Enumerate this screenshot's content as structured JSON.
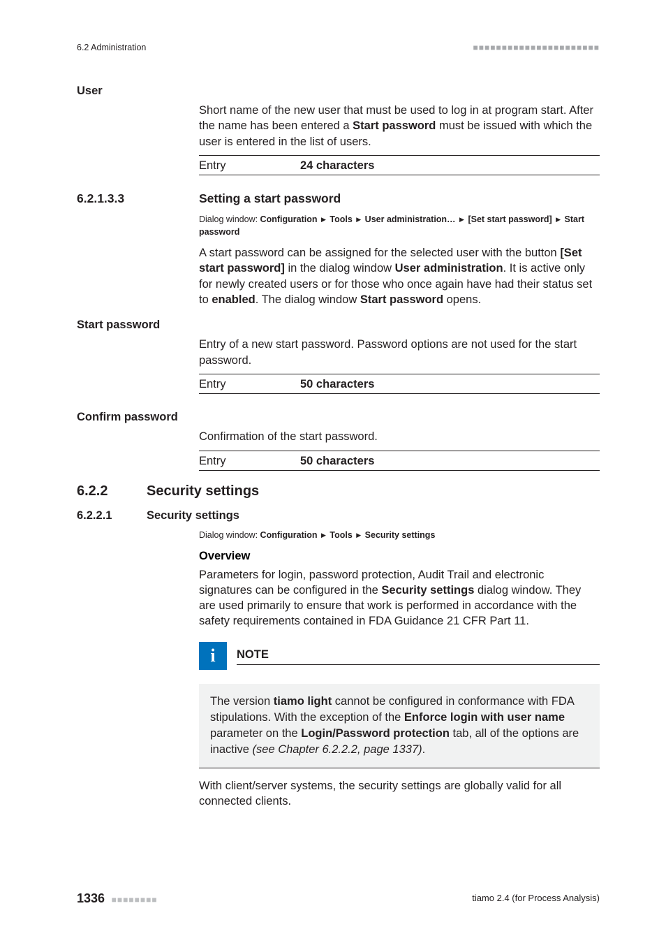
{
  "running_head": {
    "left": "6.2 Administration",
    "dots": "■■■■■■■■■■■■■■■■■■■■■■"
  },
  "user": {
    "label": "User",
    "para": "Short name of the new user that must be used to log in at program start. After the name has been entered a ",
    "bold_in_para": "Start password",
    "para_tail": " must be issued with which the user is entered in the list of users.",
    "entry_label": "Entry",
    "entry_value": "24 characters"
  },
  "sec_61_3_3": {
    "num": "6.2.1.3.3",
    "title": "Setting a start password",
    "dialog_prefix": "Dialog window: ",
    "dialog": [
      "Configuration",
      "Tools",
      "User administration…",
      "[Set start password]",
      "Start password"
    ],
    "para_parts": [
      "A start password can be assigned for the selected user with the button ",
      "[Set start password]",
      " in the dialog window ",
      "User administration",
      ". It is active only for newly created users or for those who once again have had their status set to ",
      "enabled",
      ". The dialog window ",
      "Start password",
      " opens."
    ]
  },
  "start_password": {
    "label": "Start password",
    "para": "Entry of a new start password. Password options are not used for the start password.",
    "entry_label": "Entry",
    "entry_value": "50 characters"
  },
  "confirm_password": {
    "label": "Confirm password",
    "para": "Confirmation of the start password.",
    "entry_label": "Entry",
    "entry_value": "50 characters"
  },
  "sec_622": {
    "num": "6.2.2",
    "title": "Security settings"
  },
  "sec_6221": {
    "num": "6.2.2.1",
    "title": "Security settings",
    "dialog_prefix": "Dialog window: ",
    "dialog": [
      "Configuration",
      "Tools",
      "Security settings"
    ],
    "overview_label": "Overview",
    "overview_parts": [
      "Parameters for login, password protection, Audit Trail and electronic signatures can be configured in the ",
      "Security settings",
      " dialog window. They are used primarily to ensure that work is performed in accordance with the safety requirements contained in FDA Guidance 21 CFR Part 11."
    ]
  },
  "note": {
    "title": "NOTE",
    "body_parts": [
      "The version ",
      "tiamo light",
      " cannot be configured in conformance with FDA stipulations. With the exception of the ",
      "Enforce login with user name",
      " parameter on the ",
      "Login/Password protection",
      " tab, all of the options are inactive ",
      "(see Chapter 6.2.2.2, page 1337)",
      "."
    ]
  },
  "closing_para": "With client/server systems, the security settings are globally valid for all connected clients.",
  "footer": {
    "page": "1336",
    "dots": "■■■■■■■■",
    "right": "tiamo 2.4 (for Process Analysis)"
  }
}
